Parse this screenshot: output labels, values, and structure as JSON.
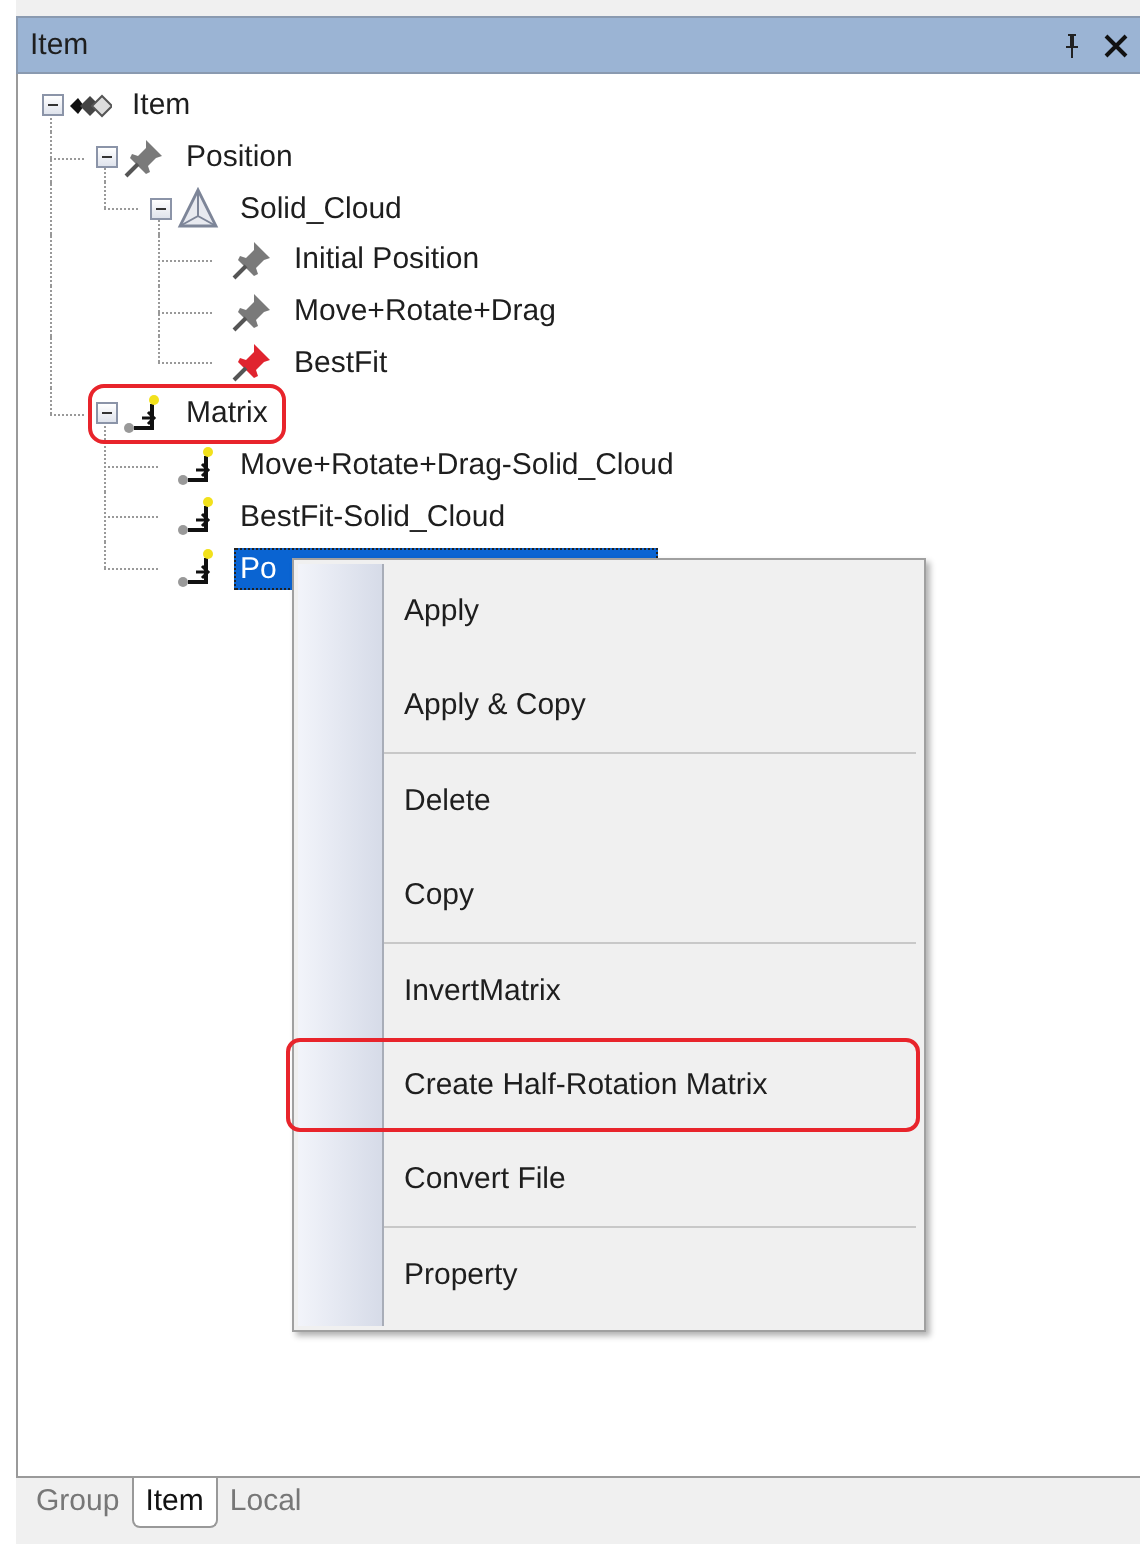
{
  "panel": {
    "title": "Item"
  },
  "tree": [
    {
      "label": "Item",
      "kind": "root",
      "expanded": true,
      "selected": false,
      "highlighted": false,
      "children": [
        {
          "label": "Position",
          "kind": "pin",
          "expanded": true,
          "selected": false,
          "highlighted": false,
          "children": [
            {
              "label": "Solid_Cloud",
              "kind": "cone",
              "expanded": true,
              "selected": false,
              "highlighted": false,
              "children": [
                {
                  "label": "Initial Position",
                  "kind": "pin",
                  "selected": false,
                  "highlighted": false
                },
                {
                  "label": "Move+Rotate+Drag",
                  "kind": "pin",
                  "selected": false,
                  "highlighted": false
                },
                {
                  "label": "BestFit",
                  "kind": "pin-red",
                  "selected": false,
                  "highlighted": false
                }
              ]
            }
          ]
        },
        {
          "label": "Matrix",
          "kind": "matrix",
          "expanded": true,
          "selected": false,
          "highlighted": true,
          "children": [
            {
              "label": "Move+Rotate+Drag-Solid_Cloud",
              "kind": "matrix",
              "selected": false,
              "highlighted": false
            },
            {
              "label": "BestFit-Solid_Cloud",
              "kind": "matrix",
              "selected": false,
              "highlighted": false
            },
            {
              "label": "Po",
              "kind": "matrix",
              "selected": true,
              "highlighted": false
            }
          ]
        }
      ]
    }
  ],
  "context_menu": [
    {
      "label": "Apply",
      "highlighted": false,
      "separator_after": false
    },
    {
      "label": "Apply & Copy",
      "highlighted": false,
      "separator_after": true
    },
    {
      "label": "Delete",
      "highlighted": false,
      "separator_after": false
    },
    {
      "label": "Copy",
      "highlighted": false,
      "separator_after": true
    },
    {
      "label": "InvertMatrix",
      "highlighted": false,
      "separator_after": false
    },
    {
      "label": "Create Half-Rotation Matrix",
      "highlighted": true,
      "separator_after": false
    },
    {
      "label": "Convert File",
      "highlighted": false,
      "separator_after": true
    },
    {
      "label": "Property",
      "highlighted": false,
      "separator_after": false
    }
  ],
  "tabs": [
    {
      "label": "Group",
      "selected": false
    },
    {
      "label": "Item",
      "selected": true
    },
    {
      "label": "Local",
      "selected": false
    }
  ]
}
